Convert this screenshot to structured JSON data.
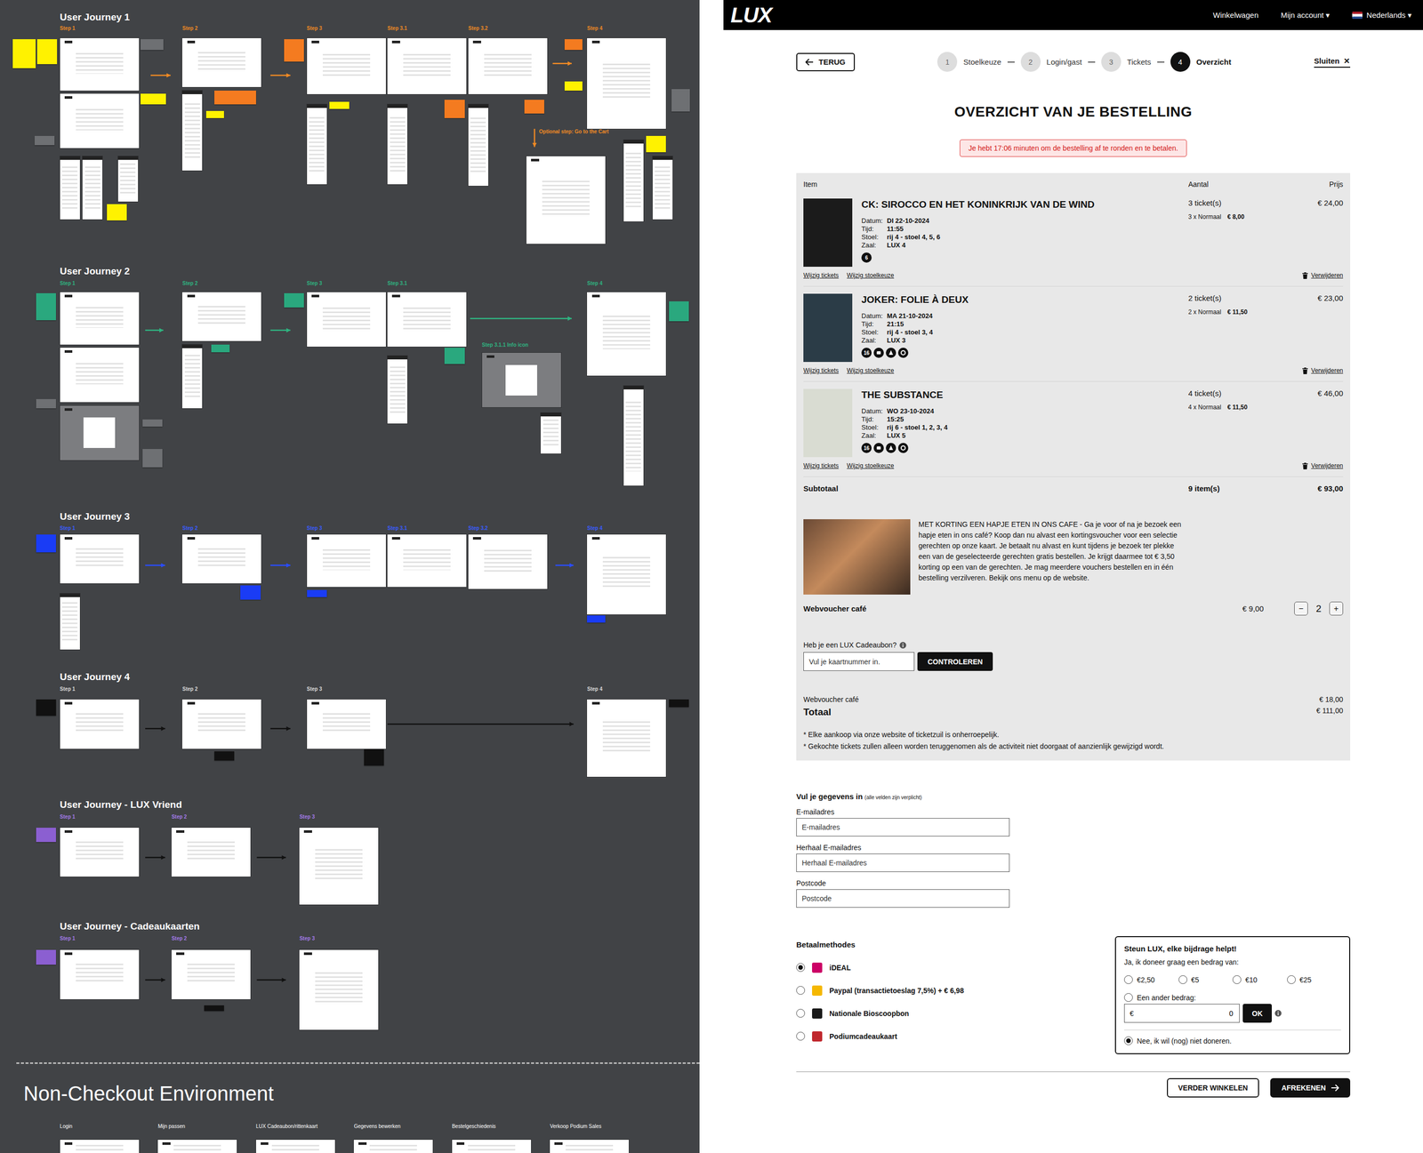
{
  "canvas": {
    "journeys": [
      {
        "title": "User Journey 1",
        "color": "#f08a24",
        "arrow_color": "#f08a24",
        "note_colors": [
          "#fff200",
          "#f47b20",
          "#6e7073"
        ],
        "steps": [
          "Step 1",
          "Step 2",
          "Step 3",
          "Step 3.1",
          "Step 3.2",
          "Step 4"
        ],
        "extra": "Optional step: Go to the Cart"
      },
      {
        "title": "User Journey 2",
        "color": "#2fb380",
        "arrow_color": "#2fb380",
        "note_colors": [
          "#2aa87e",
          "#6e7073"
        ],
        "steps": [
          "Step 1",
          "Step 2",
          "Step 3",
          "Step 3.1",
          "Step 4"
        ],
        "extra": "Step 3.1.1 Info icon"
      },
      {
        "title": "User Journey 3",
        "color": "#3a5cff",
        "arrow_color": "#2a4cff",
        "note_colors": [
          "#1a3cf5"
        ],
        "steps": [
          "Step 1",
          "Step 2",
          "Step 3",
          "Step 3.1",
          "Step 3.2",
          "Step 4"
        ]
      },
      {
        "title": "User Journey 4",
        "color": "#d8d8d8",
        "arrow_color": "#111111",
        "note_colors": [
          "#111111"
        ],
        "steps": [
          "Step 1",
          "Step 2",
          "Step 3",
          "Step 4"
        ]
      },
      {
        "title": "User Journey - LUX Vriend",
        "color": "#a27ae6",
        "arrow_color": "#111111",
        "note_colors": [
          "#8b5fd1"
        ],
        "steps": [
          "Step 1",
          "Step 2",
          "Step 3"
        ]
      },
      {
        "title": "User Journey - Cadeaukaarten",
        "color": "#a27ae6",
        "arrow_color": "#111111",
        "note_colors": [
          "#8b5fd1",
          "#111111"
        ],
        "steps": [
          "Step 1",
          "Step 2",
          "Step 3"
        ]
      }
    ],
    "section": {
      "title": "Non-Checkout Environment",
      "pages": [
        "Login",
        "Mijn passen",
        "LUX Cadeaubon/rittenkaart",
        "Gegevens bewerken",
        "Bestelgeschiedenis",
        "Verkoop Podium Sales"
      ]
    }
  },
  "header": {
    "logo": "LUX",
    "nav": [
      "Winkelwagen",
      "Mijn account ▾"
    ],
    "language": "Nederlands ▾"
  },
  "back": "TERUG",
  "steps": [
    {
      "num": "1",
      "label": "Stoelkeuze",
      "selected": false
    },
    {
      "num": "2",
      "label": "Login/gast",
      "selected": false
    },
    {
      "num": "3",
      "label": "Tickets",
      "selected": false
    },
    {
      "num": "4",
      "label": "Overzicht",
      "selected": true
    }
  ],
  "close": {
    "label": "Sluiten",
    "icon": "✕"
  },
  "title": "OVERZICHT VAN JE BESTELLING",
  "notice": "Je hebt 17:06 minuten om de bestelling af te ronden en te betalen.",
  "table": {
    "item": "Item",
    "quantity": "Aantal",
    "price": "Prijs"
  },
  "items": [
    {
      "title": "CK: SIROCCO EN HET KONINKRIJK VAN DE WIND",
      "poster_color": "#1b1b1b",
      "fields": [
        {
          "label": "Datum:",
          "value": "DI 22-10-2024"
        },
        {
          "label": "Tijd:",
          "value": "11:55"
        },
        {
          "label": "Stoel:",
          "value": "rij 4 - stoel 4, 5, 6"
        },
        {
          "label": "Zaal:",
          "value": "LUX 4"
        }
      ],
      "rating": "6",
      "content_icons": 0,
      "quantity": "3 ticket(s)",
      "breakdown": "3 x Normaal",
      "unit_price": "€ 8,00",
      "price": "€ 24,00",
      "links": [
        "Wijzig tickets",
        "Wijzig stoelkeuze"
      ],
      "remove": "Verwijderen"
    },
    {
      "title": "JOKER: FOLIE À DEUX",
      "poster_color": "#2b3c47",
      "fields": [
        {
          "label": "Datum:",
          "value": "MA 21-10-2024"
        },
        {
          "label": "Tijd:",
          "value": "21:15"
        },
        {
          "label": "Stoel:",
          "value": "rij 4 - stoel 3, 4"
        },
        {
          "label": "Zaal:",
          "value": "LUX 3"
        }
      ],
      "rating": "16",
      "content_icons": 3,
      "quantity": "2 ticket(s)",
      "breakdown": "2 x Normaal",
      "unit_price": "€ 11,50",
      "price": "€ 23,00",
      "links": [
        "Wijzig tickets",
        "Wijzig stoelkeuze"
      ],
      "remove": "Verwijderen"
    },
    {
      "title": "THE SUBSTANCE",
      "poster_color": "#d9dcd2",
      "fields": [
        {
          "label": "Datum:",
          "value": "WO 23-10-2024"
        },
        {
          "label": "Tijd:",
          "value": "15:25"
        },
        {
          "label": "Stoel:",
          "value": "rij 6 - stoel 1, 2, 3, 4"
        },
        {
          "label": "Zaal:",
          "value": "LUX 5"
        }
      ],
      "rating": "16",
      "content_icons": 3,
      "quantity": "4 ticket(s)",
      "breakdown": "4 x Normaal",
      "unit_price": "€ 11,50",
      "price": "€ 46,00",
      "links": [
        "Wijzig tickets",
        "Wijzig stoelkeuze"
      ],
      "remove": "Verwijderen"
    }
  ],
  "subtotal": {
    "label": "Subtotaal",
    "count": "9 item(s)",
    "amount": "€ 93,00"
  },
  "voucher": {
    "text": "MET KORTING EEN HAPJE ETEN IN ONS CAFE - Ga je voor of na je bezoek een hapje eten in ons café? Koop dan nu alvast een kortingsvoucher voor een selectie gerechten op onze kaart. Je betaalt nu alvast en kunt tijdens je bezoek ter plekke een van de geselecteerde gerechten gratis bestellen. Je krijgt daarmee tot € 3,50 korting op een van de gerechten. Je mag meerdere vouchers bestellen en in één bestelling verzilveren. Bekijk ons menu op de website.",
    "label": "Webvoucher café",
    "price": "€ 9,00",
    "minus": "−",
    "count": "2",
    "plus": "+"
  },
  "giftcard": {
    "label": "Heb je een LUX Cadeaubon?",
    "placeholder": "Vul je kaartnummer in.",
    "button": "CONTROLEREN"
  },
  "summary": {
    "line_label": "Webvoucher café",
    "line_amount": "€ 18,00",
    "total_label": "Totaal",
    "total_amount": "€ 111,00"
  },
  "notes": [
    "* Elke aankoop via onze website of ticketzuil is onherroepelijk.",
    "* Gekochte tickets zullen alleen worden teruggenomen als de activiteit niet doorgaat of aanzienlijk gewijzigd wordt."
  ],
  "form": {
    "title": "Vul je gegevens in",
    "hint": "(alle velden zijn verplicht)",
    "fields": [
      {
        "label": "E-mailadres",
        "placeholder": "E-mailadres"
      },
      {
        "label": "Herhaal E-mailadres",
        "placeholder": "Herhaal E-mailadres"
      },
      {
        "label": "Postcode",
        "placeholder": "Postcode"
      }
    ]
  },
  "payment": {
    "title": "Betaalmethodes",
    "options": [
      {
        "label": "iDEAL",
        "selected": true,
        "color": "#cc0066"
      },
      {
        "label": "Paypal (transactietoeslag 7,5%) + € 6,98",
        "selected": false,
        "color": "#f5b800"
      },
      {
        "label": "Nationale Bioscoopbon",
        "selected": false,
        "color": "#1a1a1a"
      },
      {
        "label": "Podiumcadeaukaart",
        "selected": false,
        "color": "#c0272d"
      }
    ]
  },
  "donate": {
    "title": "Steun LUX, elke bijdrage helpt!",
    "subtitle": "Ja, ik doneer graag een bedrag van:",
    "options": [
      {
        "label": "€2,50",
        "selected": false
      },
      {
        "label": "€5",
        "selected": false
      },
      {
        "label": "€10",
        "selected": false
      },
      {
        "label": "€25",
        "selected": false
      }
    ],
    "custom": {
      "label": "Een ander bedrag:",
      "selected": false,
      "currency": "€",
      "value": "0",
      "button": "OK"
    },
    "decline": {
      "label": "Nee, ik wil (nog) niet doneren.",
      "selected": true
    }
  },
  "buttons": {
    "continue": "VERDER WINKELEN",
    "checkout": "AFREKENEN"
  }
}
